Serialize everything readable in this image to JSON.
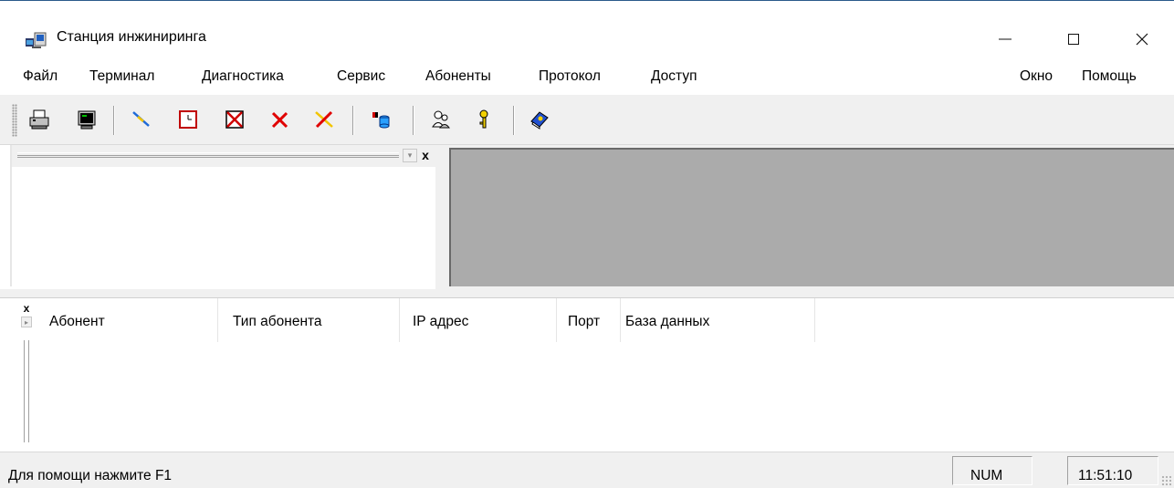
{
  "window": {
    "title": "Станция инжиниринга",
    "controls": {
      "minimize": "—",
      "maximize": "☐",
      "close": "✕"
    }
  },
  "menu": {
    "left": [
      "Файл",
      "Терминал",
      "Диагностика",
      "Сервис",
      "Абоненты",
      "Протокол",
      "Доступ"
    ],
    "right": [
      "Окно",
      "Помощь"
    ]
  },
  "toolbar": {
    "buttons": [
      {
        "icon": "printer-icon"
      },
      {
        "icon": "terminal-icon"
      },
      {
        "icon": "connect-icon"
      },
      {
        "icon": "clock-icon"
      },
      {
        "icon": "disconnect-icon"
      },
      {
        "icon": "delete-icon"
      },
      {
        "icon": "break-link-icon"
      },
      {
        "icon": "database-icon"
      },
      {
        "icon": "users-icon"
      },
      {
        "icon": "key-icon"
      },
      {
        "icon": "help-book-icon"
      }
    ]
  },
  "left_dock": {
    "close_glyph": "x",
    "menu_glyph": "▾"
  },
  "bottom_dock": {
    "close_glyph": "x",
    "columns": [
      "Абонент",
      "Тип абонента",
      "IP адрес",
      "Порт",
      "База данных"
    ]
  },
  "statusbar": {
    "message": "Для помощи нажмите F1",
    "num": "NUM",
    "time": "11:51:10"
  },
  "colors": {
    "mdi_background": "#ababab",
    "chrome": "#f0f0f0",
    "title_border": "#2b5a8a"
  }
}
